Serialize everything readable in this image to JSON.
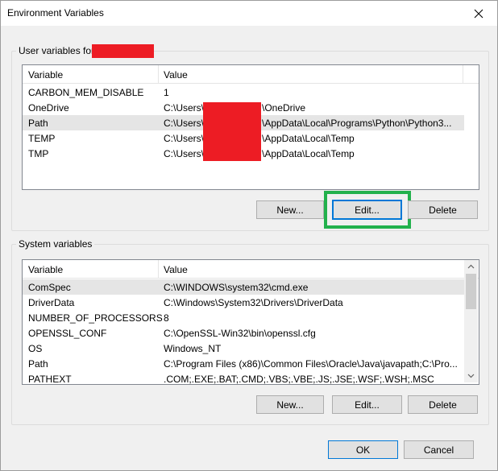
{
  "window": {
    "title": "Environment Variables",
    "close_glyph": "✕"
  },
  "user_vars": {
    "group_label": "User variables for",
    "header": {
      "variable": "Variable",
      "value": "Value"
    },
    "rows": [
      {
        "name": "CARBON_MEM_DISABLE",
        "value": "1"
      },
      {
        "name": "OneDrive",
        "value_prefix": "C:\\Users\\",
        "value_suffix": "\\OneDrive"
      },
      {
        "name": "Path",
        "value_prefix": "C:\\Users\\",
        "value_suffix": "\\AppData\\Local\\Programs\\Python\\Python3...",
        "selected": true
      },
      {
        "name": "TEMP",
        "value_prefix": "C:\\Users\\",
        "value_suffix": "\\AppData\\Local\\Temp"
      },
      {
        "name": "TMP",
        "value_prefix": "C:\\Users\\",
        "value_suffix": "\\AppData\\Local\\Temp"
      }
    ],
    "buttons": {
      "new": "New...",
      "edit": "Edit...",
      "delete": "Delete"
    }
  },
  "system_vars": {
    "group_label": "System variables",
    "header": {
      "variable": "Variable",
      "value": "Value"
    },
    "rows": [
      {
        "name": "ComSpec",
        "value": "C:\\WINDOWS\\system32\\cmd.exe",
        "selected": true
      },
      {
        "name": "DriverData",
        "value": "C:\\Windows\\System32\\Drivers\\DriverData"
      },
      {
        "name": "NUMBER_OF_PROCESSORS",
        "value": "8"
      },
      {
        "name": "OPENSSL_CONF",
        "value": "C:\\OpenSSL-Win32\\bin\\openssl.cfg"
      },
      {
        "name": "OS",
        "value": "Windows_NT"
      },
      {
        "name": "Path",
        "value": "C:\\Program Files (x86)\\Common Files\\Oracle\\Java\\javapath;C:\\Pro..."
      },
      {
        "name": "PATHEXT",
        "value": ".COM;.EXE;.BAT;.CMD;.VBS;.VBE;.JS;.JSE;.WSF;.WSH;.MSC"
      }
    ],
    "buttons": {
      "new": "New...",
      "edit": "Edit...",
      "delete": "Delete"
    }
  },
  "footer": {
    "ok": "OK",
    "cancel": "Cancel"
  },
  "colors": {
    "redaction": "#ed1c24",
    "highlight": "#22b14c",
    "focus": "#0078d7"
  }
}
